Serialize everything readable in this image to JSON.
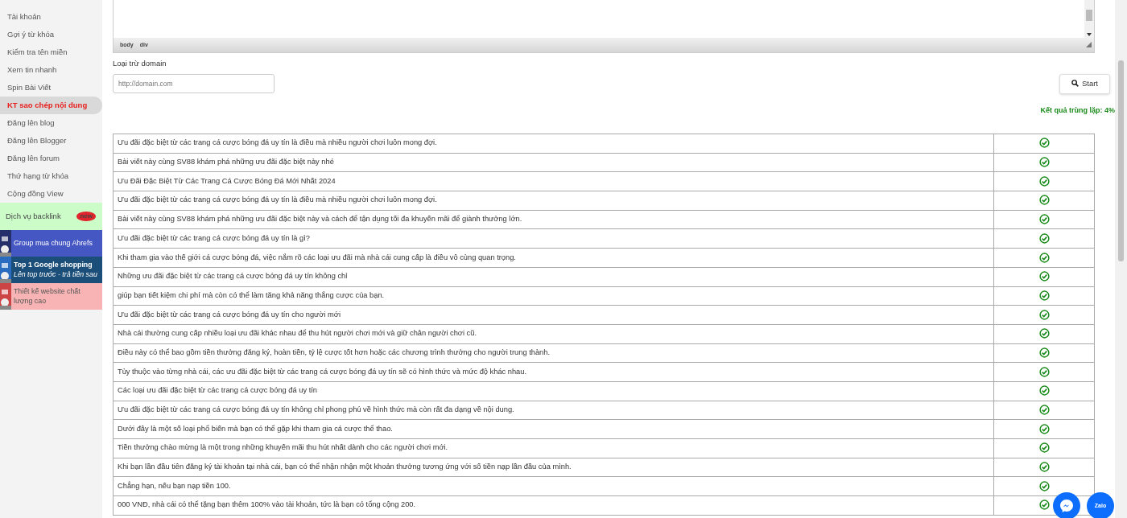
{
  "sidebar": {
    "items": [
      {
        "label": "Tài khoản",
        "selected": false
      },
      {
        "label": "Gợi ý từ khóa",
        "selected": false
      },
      {
        "label": "Kiểm tra tên miền",
        "selected": false
      },
      {
        "label": "Xem tin nhanh",
        "selected": false
      },
      {
        "label": "Spin Bài Viết",
        "selected": false
      },
      {
        "label": "KT sao chép nội dung",
        "selected": true
      },
      {
        "label": "Đăng lên blog",
        "selected": false
      },
      {
        "label": "Đăng lên Blogger",
        "selected": false
      },
      {
        "label": "Đăng lên forum",
        "selected": false
      },
      {
        "label": "Thứ hạng từ khóa",
        "selected": false
      },
      {
        "label": "Cộng đồng View",
        "selected": false
      }
    ],
    "promo": {
      "label": "Dịch vụ backlink",
      "badge": "new"
    },
    "ads": [
      {
        "kind": "plain",
        "title": "Group mua chung Ahrefs",
        "color": "#4557c2"
      },
      {
        "kind": "bold",
        "title": "Top 1 Google shopping",
        "subtitle": "Lên top trước - trả tiền sau",
        "color": "#1b4e78"
      },
      {
        "kind": "plain",
        "title": "Thiết kế website chất lượng cao",
        "color": "#f8b4b4"
      }
    ]
  },
  "editor": {
    "path": [
      "body",
      "div"
    ]
  },
  "exclude": {
    "label": "Loại trừ domain",
    "placeholder": "http://domain.com"
  },
  "start_button": "Start",
  "result": "Kết quả trùng lặp: 4%",
  "rows": [
    {
      "text": "Ưu đãi đặc biệt từ các trang cá cược bóng đá uy tín là điều mà nhiều người chơi luôn mong đợi.",
      "ok": true
    },
    {
      "text": "Bài viết này cùng SV88 khám phá những ưu đãi đặc biệt này nhé",
      "ok": true
    },
    {
      "text": "Ưu Đãi Đặc Biệt Từ Các Trang Cá Cược Bóng Đá Mới Nhất 2024",
      "ok": true
    },
    {
      "text": "Ưu đãi đặc biệt từ các trang cá cược bóng đá uy tín là điều mà nhiều người chơi luôn mong đợi.",
      "ok": true
    },
    {
      "text": "Bài viết này cùng SV88 khám phá những ưu đãi đặc biệt này và cách để tận dụng tối đa khuyến mãi để giành thưởng lớn.",
      "ok": true
    },
    {
      "text": "Ưu đãi đặc biệt từ các trang cá cược bóng đá uy tín là gì?",
      "ok": true
    },
    {
      "text": "Khi tham gia vào thế giới cá cược bóng đá, việc nắm rõ các loại ưu đãi mà nhà cái cung cấp là điều vô cùng quan trọng.",
      "ok": true
    },
    {
      "text": "Những ưu đãi đặc biệt từ các trang cá cược bóng đá uy tín không chỉ",
      "ok": true
    },
    {
      "text": "giúp bạn tiết kiệm chi phí mà còn có thể làm tăng khả năng thắng cược của bạn.",
      "ok": true
    },
    {
      "text": "Ưu đãi đặc biệt từ các trang cá cược bóng đá uy tín cho người mới",
      "ok": true
    },
    {
      "text": "Nhà cái thường cung cấp nhiều loại ưu đãi khác nhau để thu hút người chơi mới và giữ chân người chơi cũ.",
      "ok": true
    },
    {
      "text": "Điều này có thể bao gồm tiền thưởng đăng ký, hoàn tiền, tỷ lệ cược tốt hơn hoặc các chương trình thưởng cho người trung thành.",
      "ok": true
    },
    {
      "text": "Tùy thuộc vào từng nhà cái, các ưu đãi đặc biệt từ các trang cá cược bóng đá uy tín sẽ có hình thức và mức độ khác nhau.",
      "ok": true
    },
    {
      "text": "Các loại ưu đãi đặc biệt từ các trang cá cược bóng đá uy tín",
      "ok": true
    },
    {
      "text": "Ưu đãi đặc biệt từ các trang cá cược bóng đá uy tín không chỉ phong phú về hình thức mà còn rất đa dạng về nội dung.",
      "ok": true
    },
    {
      "text": "Dưới đây là một số loại phổ biến mà bạn có thể gặp khi tham gia cá cược thể thao.",
      "ok": true
    },
    {
      "text": "Tiền thưởng chào mừng là một trong những khuyến mãi thu hút nhất dành cho các người chơi mới.",
      "ok": true
    },
    {
      "text": "Khi bạn lần đầu tiên đăng ký tài khoản tại nhà cái, bạn có thể nhận nhận một khoản thưởng tương ứng với số tiền nạp lần đầu của mình.",
      "ok": true
    },
    {
      "text": "Chẳng hạn, nếu bạn nạp tiền 100.",
      "ok": true
    },
    {
      "text": "000 VNĐ, nhà cái có thể tặng bạn thêm 100% vào tài khoản, tức là bạn có tổng cộng 200.",
      "ok": true
    }
  ],
  "chat": {
    "zalo": "Zalo"
  }
}
